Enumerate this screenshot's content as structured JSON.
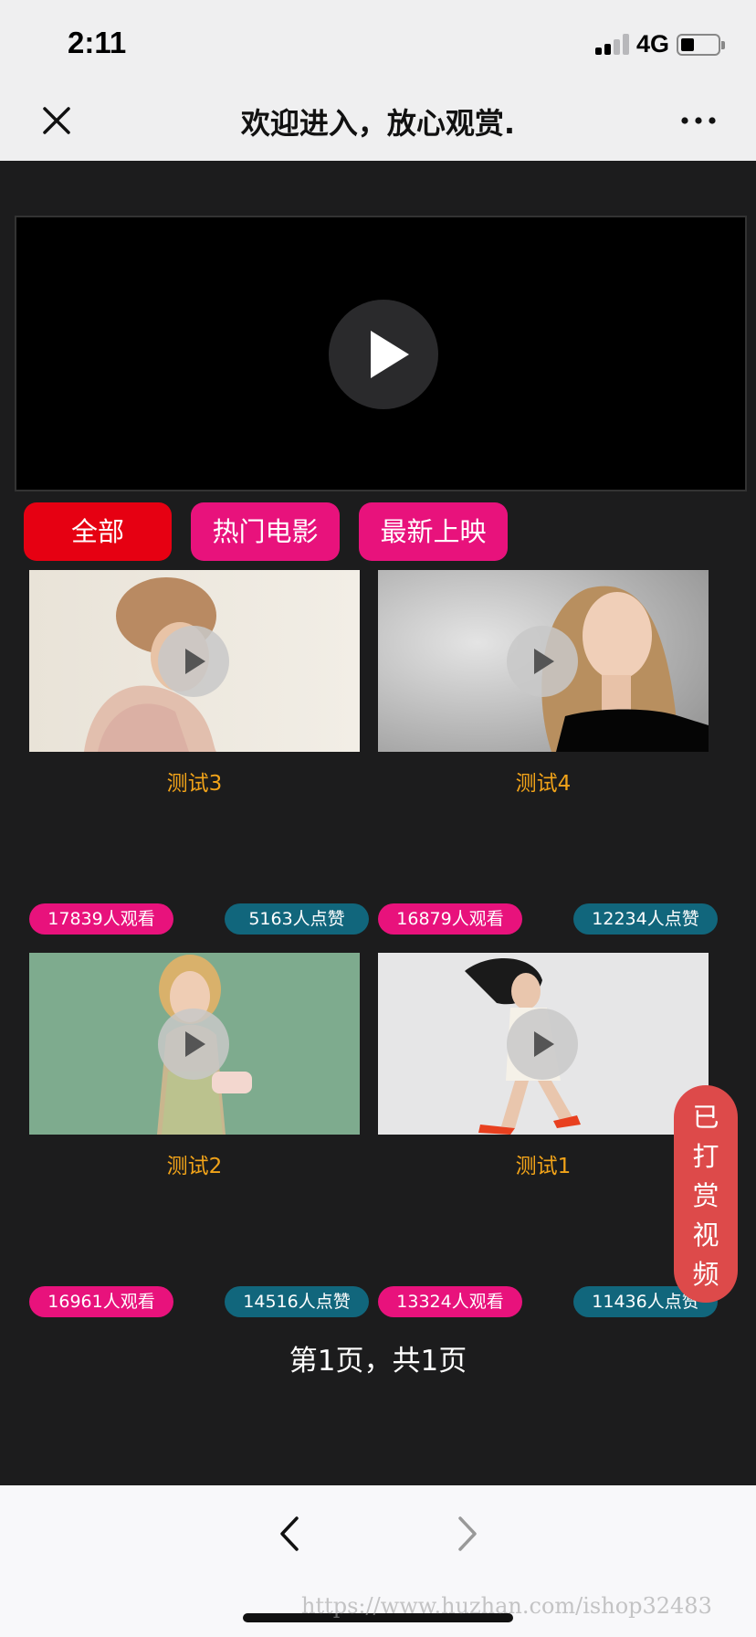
{
  "status_bar": {
    "time": "2:11",
    "network": "4G"
  },
  "nav": {
    "title": "欢迎进入，放心观赏.",
    "close_icon": "close-icon",
    "more_icon": "more-icon"
  },
  "tabs": [
    {
      "label": "全部",
      "active": true
    },
    {
      "label": "热门电影",
      "active": false
    },
    {
      "label": "最新上映",
      "active": false
    }
  ],
  "videos": [
    {
      "title": "测试3",
      "views": "17839人观看",
      "likes": "5163人点赞"
    },
    {
      "title": "测试4",
      "views": "16879人观看",
      "likes": "12234人点赞"
    },
    {
      "title": "测试2",
      "views": "16961人观看",
      "likes": "14516人点赞"
    },
    {
      "title": "测试1",
      "views": "13324人观看",
      "likes": "11436人点赞"
    }
  ],
  "pager": "第1页，共1页",
  "float_button": {
    "chars": [
      "已",
      "打",
      "赏",
      "视",
      "频"
    ]
  },
  "watermark": "https://www.huzhan.com/ishop32483",
  "colors": {
    "accent_red": "#e60012",
    "accent_pink": "#e8127c",
    "likes_teal": "#11667c",
    "title_orange": "#f1a319"
  }
}
